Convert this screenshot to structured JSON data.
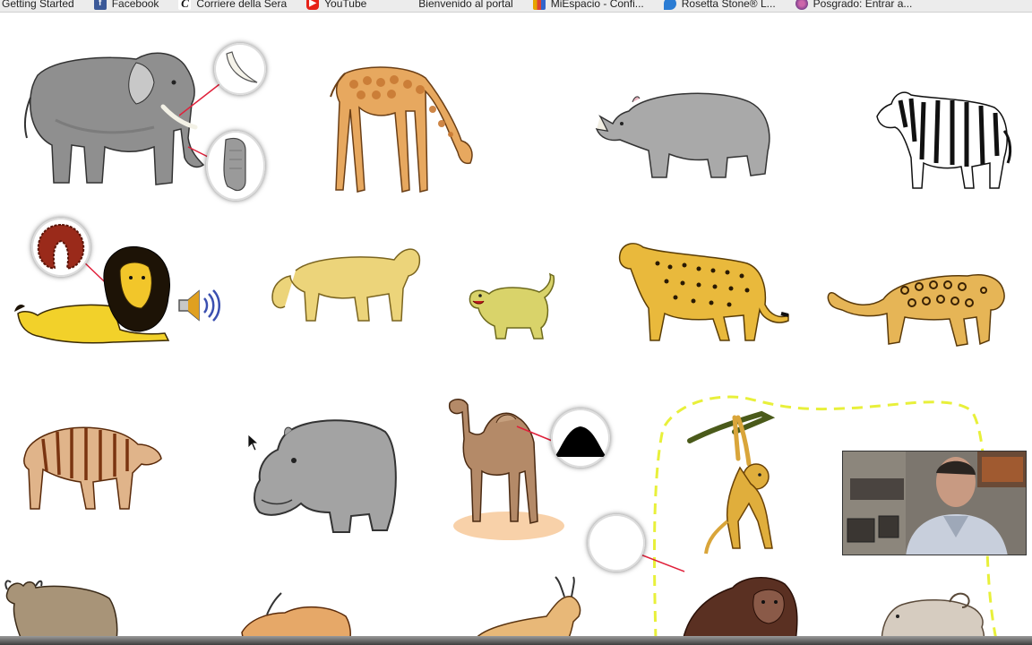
{
  "bookmarks": [
    {
      "label": "Getting Started",
      "icon": "none",
      "color": "#ececec"
    },
    {
      "label": "Facebook",
      "icon": "facebook-icon",
      "color": "#3b5998"
    },
    {
      "label": "Corriere della Sera",
      "icon": "corriere-icon",
      "color": "#111111"
    },
    {
      "label": "YouTube",
      "icon": "youtube-icon",
      "color": "#e62117"
    },
    {
      "label": "Bienvenido al portal",
      "icon": "none",
      "color": "#ececec"
    },
    {
      "label": "MiEspacio - Confi...",
      "icon": "miespacio-icon",
      "color": "#e6a500"
    },
    {
      "label": "Rosetta Stone® L...",
      "icon": "rosetta-icon",
      "color": "#2b7cd3"
    },
    {
      "label": "Posgrado: Entrar a...",
      "icon": "globe-icon",
      "color": "#7a3f8c"
    }
  ],
  "animals": [
    "elephant",
    "giraffe",
    "rhinoceros",
    "zebra",
    "lion",
    "lioness",
    "lion-cub",
    "cheetah",
    "leopard",
    "hyena",
    "hippopotamus",
    "camel",
    "spider-monkey",
    "wildebeest",
    "antelope",
    "gazelle",
    "gorilla",
    "baboon"
  ],
  "icons": {
    "speaker": "speaker-icon",
    "cursor": "mouse-cursor-icon"
  },
  "colors": {
    "annotation_line": "#e0203a",
    "dashed_path": "#e8f03a",
    "elephant_gray": "#8f8f8f"
  }
}
